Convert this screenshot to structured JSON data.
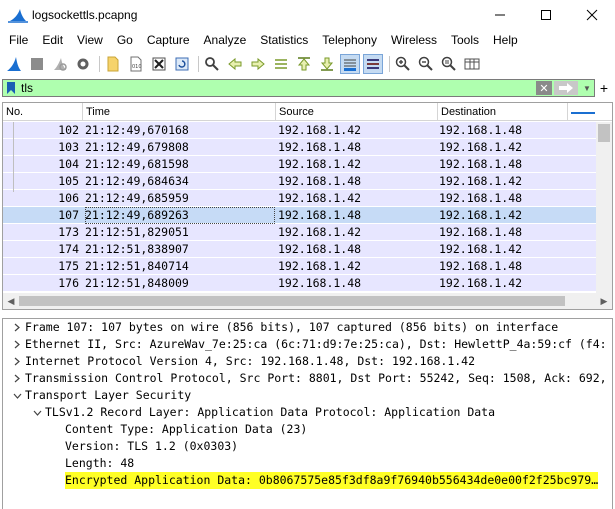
{
  "window": {
    "title": "logsockettls.pcapng",
    "controls": [
      "minimize-icon",
      "maximize-icon",
      "close-icon"
    ]
  },
  "menu": [
    "File",
    "Edit",
    "View",
    "Go",
    "Capture",
    "Analyze",
    "Statistics",
    "Telephony",
    "Wireless",
    "Tools",
    "Help"
  ],
  "toolbar": {
    "icons": [
      "shark-fin-start-icon",
      "stop-square-icon",
      "restart-icon",
      "options-gear-icon",
      "open-file-icon",
      "save-file-icon",
      "close-file-icon",
      "reload-icon",
      "find-icon",
      "go-back-icon",
      "go-forward-icon",
      "go-to-packet-icon",
      "first-packet-icon",
      "last-packet-icon",
      "autoscroll-icon",
      "colorize-icon",
      "zoom-in-icon",
      "zoom-out-icon",
      "zoom-normal-icon",
      "resize-columns-icon"
    ]
  },
  "filter": {
    "value": "tls",
    "colors": {
      "valid": "#afffaf"
    }
  },
  "packet_list": {
    "columns": [
      "No.",
      "Time",
      "Source",
      "Destination"
    ],
    "rows": [
      {
        "no": "102",
        "time": "21:12:49,670168",
        "source": "192.168.1.42",
        "destination": "192.168.1.48",
        "selected": false
      },
      {
        "no": "103",
        "time": "21:12:49,679808",
        "source": "192.168.1.48",
        "destination": "192.168.1.42",
        "selected": false
      },
      {
        "no": "104",
        "time": "21:12:49,681598",
        "source": "192.168.1.42",
        "destination": "192.168.1.48",
        "selected": false
      },
      {
        "no": "105",
        "time": "21:12:49,684634",
        "source": "192.168.1.48",
        "destination": "192.168.1.42",
        "selected": false
      },
      {
        "no": "106",
        "time": "21:12:49,685959",
        "source": "192.168.1.42",
        "destination": "192.168.1.48",
        "selected": false
      },
      {
        "no": "107",
        "time": "21:12:49,689263",
        "source": "192.168.1.48",
        "destination": "192.168.1.42",
        "selected": true
      },
      {
        "no": "173",
        "time": "21:12:51,829051",
        "source": "192.168.1.42",
        "destination": "192.168.1.48",
        "selected": false
      },
      {
        "no": "174",
        "time": "21:12:51,838907",
        "source": "192.168.1.48",
        "destination": "192.168.1.42",
        "selected": false
      },
      {
        "no": "175",
        "time": "21:12:51,840714",
        "source": "192.168.1.42",
        "destination": "192.168.1.48",
        "selected": false
      },
      {
        "no": "176",
        "time": "21:12:51,848009",
        "source": "192.168.1.48",
        "destination": "192.168.1.42",
        "selected": false
      }
    ],
    "colors": {
      "row": "#e7e6ff",
      "selected": "#c6dbf6"
    }
  },
  "details": {
    "lines": [
      {
        "text": "Frame 107: 107 bytes on wire (856 bits), 107 captured (856 bits) on interface",
        "level": 0,
        "toggle": "collapsed",
        "highlight": false
      },
      {
        "text": "Ethernet II, Src: AzureWav_7e:25:ca (6c:71:d9:7e:25:ca), Dst: HewlettP_4a:59:cf (f4:",
        "level": 0,
        "toggle": "collapsed",
        "highlight": false
      },
      {
        "text": "Internet Protocol Version 4, Src: 192.168.1.48, Dst: 192.168.1.42",
        "level": 0,
        "toggle": "collapsed",
        "highlight": false
      },
      {
        "text": "Transmission Control Protocol, Src Port: 8801, Dst Port: 55242, Seq: 1508, Ack: 692,",
        "level": 0,
        "toggle": "collapsed",
        "highlight": false
      },
      {
        "text": "Transport Layer Security",
        "level": 0,
        "toggle": "expanded",
        "highlight": false
      },
      {
        "text": "TLSv1.2 Record Layer: Application Data Protocol: Application Data",
        "level": 1,
        "toggle": "expanded",
        "highlight": false
      },
      {
        "text": "Content Type: Application Data (23)",
        "level": 2,
        "toggle": "none",
        "highlight": false
      },
      {
        "text": "Version: TLS 1.2 (0x0303)",
        "level": 2,
        "toggle": "none",
        "highlight": false
      },
      {
        "text": "Length: 48",
        "level": 2,
        "toggle": "none",
        "highlight": false
      },
      {
        "text": "Encrypted Application Data: 0b8067575e85f3df8a9f76940b556434de0e00f2f25bc979…",
        "level": 2,
        "toggle": "none",
        "highlight": true
      }
    ],
    "colors": {
      "highlight": "#ffff26"
    }
  }
}
